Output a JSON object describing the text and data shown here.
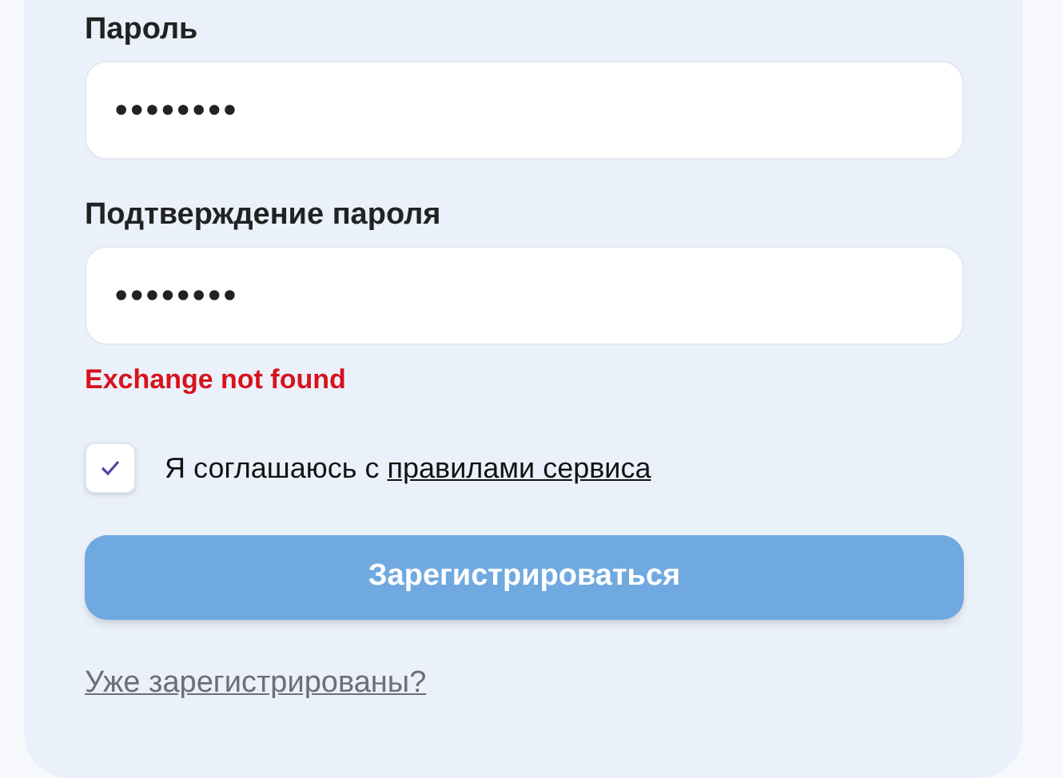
{
  "fields": [
    {
      "label": "Пароль",
      "value": "••••••••"
    },
    {
      "label": "Подтверждение пароля",
      "value": "••••••••"
    }
  ],
  "error": "Exchange not found",
  "agreement": {
    "checked": true,
    "text": "Я соглашаюсь с",
    "link": "правилами сервиса"
  },
  "submit": {
    "label": "Зарегистрироваться",
    "disabled": true
  },
  "login_link": "Уже зарегистрированы?"
}
